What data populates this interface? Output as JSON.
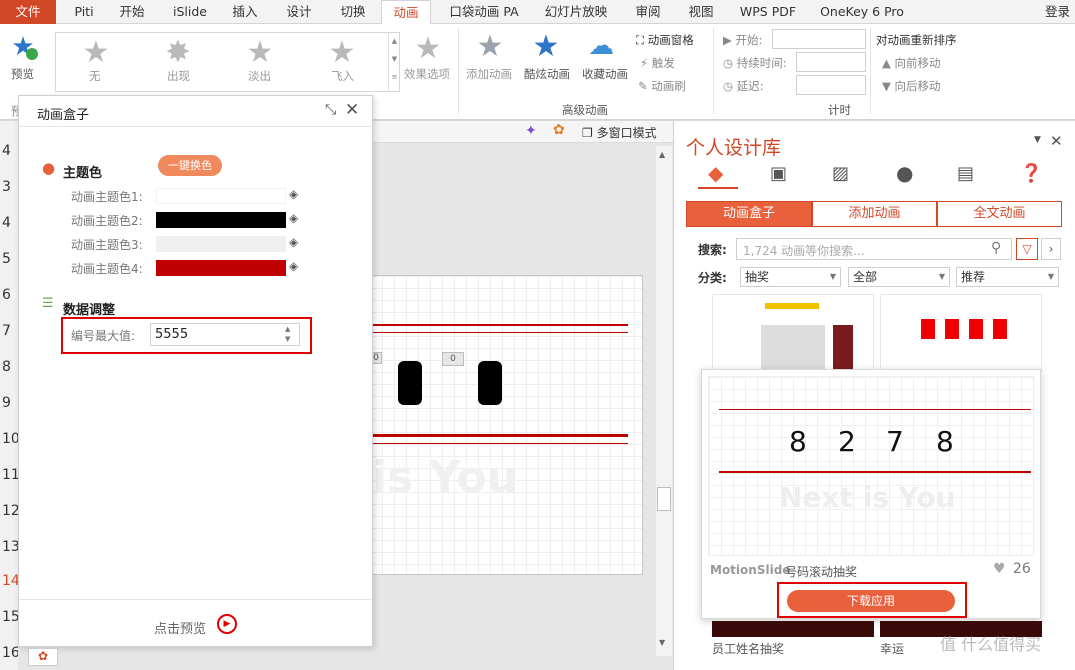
{
  "tabs": {
    "file": "文件",
    "t1": "Piti",
    "t2": "开始",
    "t3": "iSlide",
    "t4": "插入",
    "t5": "设计",
    "t6": "切换",
    "t7": "动画",
    "t8": "口袋动画 PA",
    "t9": "幻灯片放映",
    "t10": "审阅",
    "t11": "视图",
    "t12": "WPS PDF",
    "t13": "OneKey 6 Pro",
    "login": "登录"
  },
  "ribbon": {
    "preview": "预览",
    "preview_cut": "预",
    "effects": {
      "none": "无",
      "appear": "出现",
      "fade": "淡出",
      "fly": "飞入"
    },
    "effect_options": "效果选项",
    "add_anim": "添加动画",
    "cool_anim": "酷炫动画",
    "fav_anim": "收藏动画",
    "anim_pane": "动画窗格",
    "trigger": "触发",
    "anim_brush": "动画刷",
    "group_advanced": "高级动画",
    "start": "开始:",
    "duration": "持续时间:",
    "delay": "延迟:",
    "group_timing": "计时",
    "reorder": "对动画重新排序",
    "move_earlier": "向前移动",
    "move_later": "向后移动"
  },
  "sub_toolbar": {
    "multiwin": "多窗口模式"
  },
  "slide_numbers": [
    "4",
    "3",
    "4",
    "5",
    "6",
    "7",
    "8",
    "9",
    "10",
    "11",
    "12",
    "13",
    "14",
    "15",
    "16"
  ],
  "dialog": {
    "title": "动画盒子",
    "theme_color": "主题色",
    "one_key": "一键换色",
    "color_rows": [
      {
        "label": "动画主题色1:",
        "color": "#ffffff"
      },
      {
        "label": "动画主题色2:",
        "color": "#000000"
      },
      {
        "label": "动画主题色3:",
        "color": "#f0f0f0"
      },
      {
        "label": "动画主题色4:",
        "color": "#c00000"
      }
    ],
    "data_adjust": "数据调整",
    "max_label": "编号最大值:",
    "max_value": "5555",
    "preview": "点击预览"
  },
  "slide": {
    "small0": "0",
    "watermark": "is You"
  },
  "panel": {
    "title": "个人设计库",
    "tabs": [
      "动画盒子",
      "添加动画",
      "全文动画"
    ],
    "search_label": "搜索:",
    "search_placeholder": "1,724 动画等你搜索...",
    "cat_label": "分类:",
    "cat1": "抽奖",
    "cat2": "全部",
    "cat3": "推荐",
    "popup": {
      "digits": [
        "8",
        "2",
        "7",
        "8"
      ],
      "watermark": "Next is You",
      "brand": "MotionSlide",
      "name": "号码滚动抽奖",
      "likes": "26",
      "apply": "下载应用"
    },
    "bottom1": "员工姓名抽奖",
    "bottom2": "幸运",
    "site": "什么值得买"
  },
  "colors": {
    "accent": "#d24726",
    "button": "#e8603c",
    "highlight": "#e00000"
  }
}
